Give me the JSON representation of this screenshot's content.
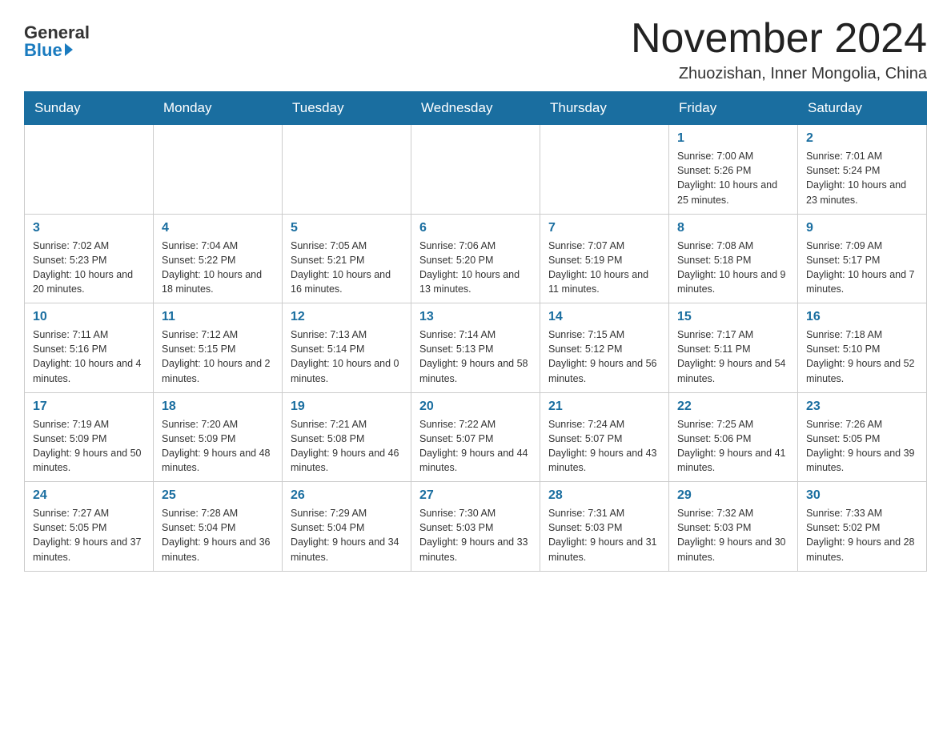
{
  "header": {
    "logo_general": "General",
    "logo_blue": "Blue",
    "month_title": "November 2024",
    "location": "Zhuozishan, Inner Mongolia, China"
  },
  "weekdays": [
    "Sunday",
    "Monday",
    "Tuesday",
    "Wednesday",
    "Thursday",
    "Friday",
    "Saturday"
  ],
  "weeks": [
    [
      {
        "day": "",
        "info": ""
      },
      {
        "day": "",
        "info": ""
      },
      {
        "day": "",
        "info": ""
      },
      {
        "day": "",
        "info": ""
      },
      {
        "day": "",
        "info": ""
      },
      {
        "day": "1",
        "info": "Sunrise: 7:00 AM\nSunset: 5:26 PM\nDaylight: 10 hours and 25 minutes."
      },
      {
        "day": "2",
        "info": "Sunrise: 7:01 AM\nSunset: 5:24 PM\nDaylight: 10 hours and 23 minutes."
      }
    ],
    [
      {
        "day": "3",
        "info": "Sunrise: 7:02 AM\nSunset: 5:23 PM\nDaylight: 10 hours and 20 minutes."
      },
      {
        "day": "4",
        "info": "Sunrise: 7:04 AM\nSunset: 5:22 PM\nDaylight: 10 hours and 18 minutes."
      },
      {
        "day": "5",
        "info": "Sunrise: 7:05 AM\nSunset: 5:21 PM\nDaylight: 10 hours and 16 minutes."
      },
      {
        "day": "6",
        "info": "Sunrise: 7:06 AM\nSunset: 5:20 PM\nDaylight: 10 hours and 13 minutes."
      },
      {
        "day": "7",
        "info": "Sunrise: 7:07 AM\nSunset: 5:19 PM\nDaylight: 10 hours and 11 minutes."
      },
      {
        "day": "8",
        "info": "Sunrise: 7:08 AM\nSunset: 5:18 PM\nDaylight: 10 hours and 9 minutes."
      },
      {
        "day": "9",
        "info": "Sunrise: 7:09 AM\nSunset: 5:17 PM\nDaylight: 10 hours and 7 minutes."
      }
    ],
    [
      {
        "day": "10",
        "info": "Sunrise: 7:11 AM\nSunset: 5:16 PM\nDaylight: 10 hours and 4 minutes."
      },
      {
        "day": "11",
        "info": "Sunrise: 7:12 AM\nSunset: 5:15 PM\nDaylight: 10 hours and 2 minutes."
      },
      {
        "day": "12",
        "info": "Sunrise: 7:13 AM\nSunset: 5:14 PM\nDaylight: 10 hours and 0 minutes."
      },
      {
        "day": "13",
        "info": "Sunrise: 7:14 AM\nSunset: 5:13 PM\nDaylight: 9 hours and 58 minutes."
      },
      {
        "day": "14",
        "info": "Sunrise: 7:15 AM\nSunset: 5:12 PM\nDaylight: 9 hours and 56 minutes."
      },
      {
        "day": "15",
        "info": "Sunrise: 7:17 AM\nSunset: 5:11 PM\nDaylight: 9 hours and 54 minutes."
      },
      {
        "day": "16",
        "info": "Sunrise: 7:18 AM\nSunset: 5:10 PM\nDaylight: 9 hours and 52 minutes."
      }
    ],
    [
      {
        "day": "17",
        "info": "Sunrise: 7:19 AM\nSunset: 5:09 PM\nDaylight: 9 hours and 50 minutes."
      },
      {
        "day": "18",
        "info": "Sunrise: 7:20 AM\nSunset: 5:09 PM\nDaylight: 9 hours and 48 minutes."
      },
      {
        "day": "19",
        "info": "Sunrise: 7:21 AM\nSunset: 5:08 PM\nDaylight: 9 hours and 46 minutes."
      },
      {
        "day": "20",
        "info": "Sunrise: 7:22 AM\nSunset: 5:07 PM\nDaylight: 9 hours and 44 minutes."
      },
      {
        "day": "21",
        "info": "Sunrise: 7:24 AM\nSunset: 5:07 PM\nDaylight: 9 hours and 43 minutes."
      },
      {
        "day": "22",
        "info": "Sunrise: 7:25 AM\nSunset: 5:06 PM\nDaylight: 9 hours and 41 minutes."
      },
      {
        "day": "23",
        "info": "Sunrise: 7:26 AM\nSunset: 5:05 PM\nDaylight: 9 hours and 39 minutes."
      }
    ],
    [
      {
        "day": "24",
        "info": "Sunrise: 7:27 AM\nSunset: 5:05 PM\nDaylight: 9 hours and 37 minutes."
      },
      {
        "day": "25",
        "info": "Sunrise: 7:28 AM\nSunset: 5:04 PM\nDaylight: 9 hours and 36 minutes."
      },
      {
        "day": "26",
        "info": "Sunrise: 7:29 AM\nSunset: 5:04 PM\nDaylight: 9 hours and 34 minutes."
      },
      {
        "day": "27",
        "info": "Sunrise: 7:30 AM\nSunset: 5:03 PM\nDaylight: 9 hours and 33 minutes."
      },
      {
        "day": "28",
        "info": "Sunrise: 7:31 AM\nSunset: 5:03 PM\nDaylight: 9 hours and 31 minutes."
      },
      {
        "day": "29",
        "info": "Sunrise: 7:32 AM\nSunset: 5:03 PM\nDaylight: 9 hours and 30 minutes."
      },
      {
        "day": "30",
        "info": "Sunrise: 7:33 AM\nSunset: 5:02 PM\nDaylight: 9 hours and 28 minutes."
      }
    ]
  ]
}
